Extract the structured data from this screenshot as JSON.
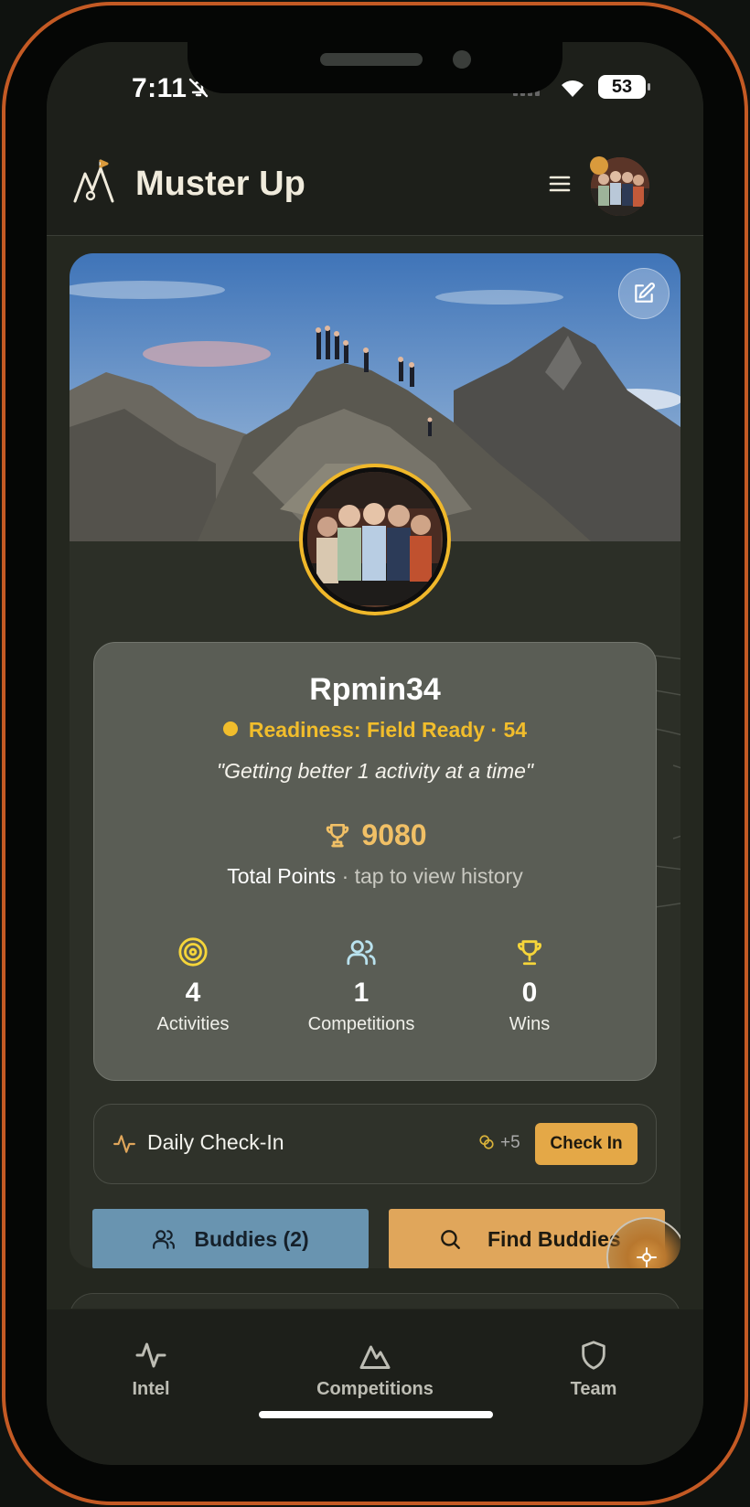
{
  "status_bar": {
    "time": "7:11",
    "battery": "53"
  },
  "header": {
    "title": "Muster Up",
    "menu_icon": "menu-icon",
    "avatar_alt": "profile avatar"
  },
  "profile": {
    "username": "Rpmin34",
    "readiness": "Readiness: Field Ready · 54",
    "motto": "\"Getting better 1 activity at a time\"",
    "points": "9080",
    "points_label": "Total Points",
    "points_hint": " · tap to view history",
    "stats": [
      {
        "value": "4",
        "label": "Activities",
        "icon": "target-icon"
      },
      {
        "value": "1",
        "label": "Competitions",
        "icon": "users-icon"
      },
      {
        "value": "0",
        "label": "Wins",
        "icon": "trophy-icon"
      }
    ]
  },
  "checkin": {
    "label": "Daily Check-In",
    "bonus": "+5",
    "button": "Check In"
  },
  "actions": {
    "buddies": "Buddies (2)",
    "find": "Find Buddies"
  },
  "nav": [
    {
      "label": "Intel",
      "icon": "activity-icon"
    },
    {
      "label": "Competitions",
      "icon": "mountain-icon"
    },
    {
      "label": "Team",
      "icon": "shield-icon"
    }
  ],
  "colors": {
    "accent": "#f1bd2c",
    "orange": "#e0a65b",
    "blue": "#6994b0",
    "bg": "#24271f"
  }
}
